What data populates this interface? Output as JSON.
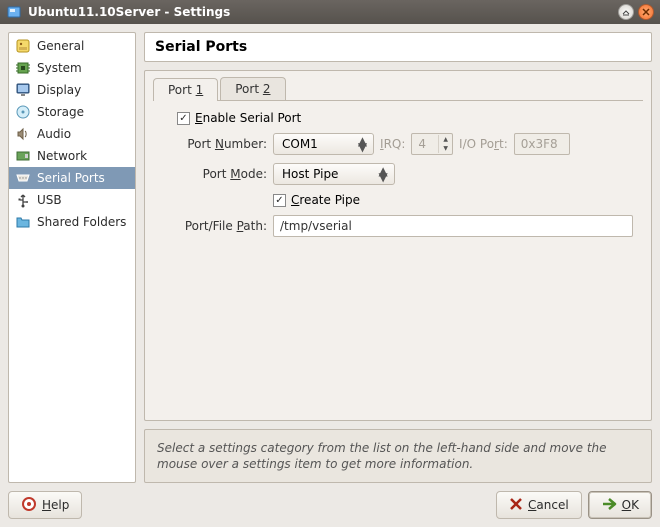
{
  "window": {
    "title": "Ubuntu11.10Server - Settings"
  },
  "sidebar": {
    "items": [
      {
        "label": "General"
      },
      {
        "label": "System"
      },
      {
        "label": "Display"
      },
      {
        "label": "Storage"
      },
      {
        "label": "Audio"
      },
      {
        "label": "Network"
      },
      {
        "label": "Serial Ports",
        "selected": true
      },
      {
        "label": "USB"
      },
      {
        "label": "Shared Folders"
      }
    ]
  },
  "panel": {
    "title": "Serial Ports"
  },
  "tabs": [
    {
      "prefix": "Port ",
      "accel": "1"
    },
    {
      "prefix": "Port ",
      "accel": "2"
    }
  ],
  "form": {
    "enable_prefix": "",
    "enable_accel": "E",
    "enable_suffix": "nable Serial Port",
    "enable_checked": true,
    "portnum_prefix": "Port ",
    "portnum_accel": "N",
    "portnum_suffix": "umber:",
    "portnum_value": "COM1",
    "irq_accel": "I",
    "irq_label_suffix": "RQ:",
    "irq_value": "4",
    "ioport_label_prefix": "I/O Po",
    "ioport_accel": "r",
    "ioport_suffix": "t:",
    "ioport_value": "0x3F8",
    "mode_prefix": "Port ",
    "mode_accel": "M",
    "mode_suffix": "ode:",
    "mode_value": "Host Pipe",
    "createpipe_accel": "C",
    "createpipe_suffix": "reate Pipe",
    "createpipe_checked": true,
    "path_prefix": "Port/File ",
    "path_accel": "P",
    "path_suffix": "ath:",
    "path_value": "/tmp/vserial"
  },
  "hint": "Select a settings category from the list on the left-hand side and move the mouse over a settings item to get more information.",
  "buttons": {
    "help_accel": "H",
    "help_suffix": "elp",
    "cancel_accel": "C",
    "cancel_suffix": "ancel",
    "ok_accel": "O",
    "ok_suffix": "K"
  }
}
